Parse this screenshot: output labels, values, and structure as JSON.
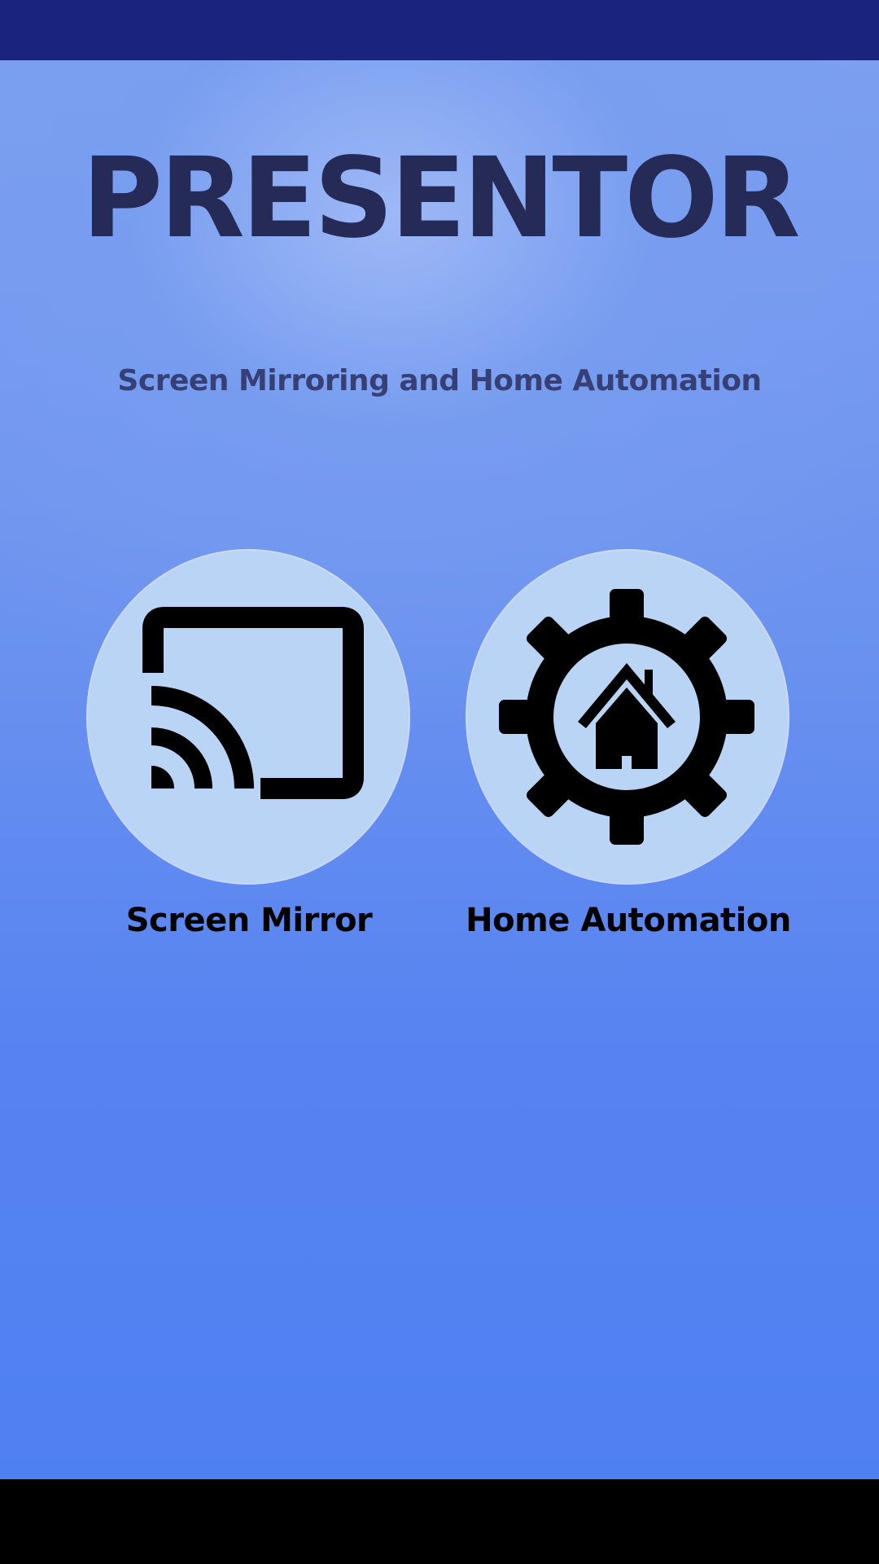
{
  "app": {
    "title": "PRESENTOR",
    "subtitle": "Screen Mirroring and Home Automation"
  },
  "features": [
    {
      "label": "Screen Mirror",
      "icon": "cast-icon"
    },
    {
      "label": "Home Automation",
      "icon": "home-gear-icon"
    }
  ],
  "colors": {
    "status_bar": "#1a237e",
    "background": "#4f80f2",
    "title": "#262a57",
    "subtitle": "#373f77",
    "circle": "#bad4f6",
    "nav_bar": "#000000"
  }
}
